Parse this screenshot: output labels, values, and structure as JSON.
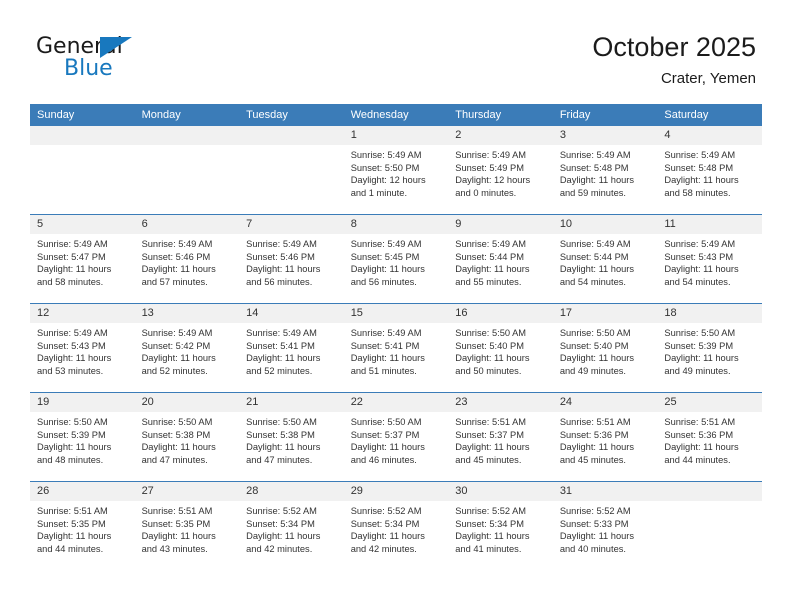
{
  "logo": {
    "word_one": "General",
    "word_two": "Blue",
    "triangle_color": "#1878be",
    "text_color": "#1b1b1b"
  },
  "header": {
    "title": "October 2025",
    "subtitle": "Crater, Yemen"
  },
  "theme": {
    "header_bg": "#3b7cb8",
    "header_text": "#ffffff",
    "date_band_bg": "#f1f1f1",
    "row_divider": "#3b7cb8",
    "body_text": "#333333"
  },
  "calendar": {
    "weekday_headers": [
      "Sunday",
      "Monday",
      "Tuesday",
      "Wednesday",
      "Thursday",
      "Friday",
      "Saturday"
    ],
    "weeks": [
      [
        {
          "date": "",
          "empty": true,
          "sunrise": "",
          "sunset": "",
          "daylight": ""
        },
        {
          "date": "",
          "empty": true,
          "sunrise": "",
          "sunset": "",
          "daylight": ""
        },
        {
          "date": "",
          "empty": true,
          "sunrise": "",
          "sunset": "",
          "daylight": ""
        },
        {
          "date": "1",
          "empty": false,
          "sunrise": "Sunrise: 5:49 AM",
          "sunset": "Sunset: 5:50 PM",
          "daylight": "Daylight: 12 hours and 1 minute."
        },
        {
          "date": "2",
          "empty": false,
          "sunrise": "Sunrise: 5:49 AM",
          "sunset": "Sunset: 5:49 PM",
          "daylight": "Daylight: 12 hours and 0 minutes."
        },
        {
          "date": "3",
          "empty": false,
          "sunrise": "Sunrise: 5:49 AM",
          "sunset": "Sunset: 5:48 PM",
          "daylight": "Daylight: 11 hours and 59 minutes."
        },
        {
          "date": "4",
          "empty": false,
          "sunrise": "Sunrise: 5:49 AM",
          "sunset": "Sunset: 5:48 PM",
          "daylight": "Daylight: 11 hours and 58 minutes."
        }
      ],
      [
        {
          "date": "5",
          "empty": false,
          "sunrise": "Sunrise: 5:49 AM",
          "sunset": "Sunset: 5:47 PM",
          "daylight": "Daylight: 11 hours and 58 minutes."
        },
        {
          "date": "6",
          "empty": false,
          "sunrise": "Sunrise: 5:49 AM",
          "sunset": "Sunset: 5:46 PM",
          "daylight": "Daylight: 11 hours and 57 minutes."
        },
        {
          "date": "7",
          "empty": false,
          "sunrise": "Sunrise: 5:49 AM",
          "sunset": "Sunset: 5:46 PM",
          "daylight": "Daylight: 11 hours and 56 minutes."
        },
        {
          "date": "8",
          "empty": false,
          "sunrise": "Sunrise: 5:49 AM",
          "sunset": "Sunset: 5:45 PM",
          "daylight": "Daylight: 11 hours and 56 minutes."
        },
        {
          "date": "9",
          "empty": false,
          "sunrise": "Sunrise: 5:49 AM",
          "sunset": "Sunset: 5:44 PM",
          "daylight": "Daylight: 11 hours and 55 minutes."
        },
        {
          "date": "10",
          "empty": false,
          "sunrise": "Sunrise: 5:49 AM",
          "sunset": "Sunset: 5:44 PM",
          "daylight": "Daylight: 11 hours and 54 minutes."
        },
        {
          "date": "11",
          "empty": false,
          "sunrise": "Sunrise: 5:49 AM",
          "sunset": "Sunset: 5:43 PM",
          "daylight": "Daylight: 11 hours and 54 minutes."
        }
      ],
      [
        {
          "date": "12",
          "empty": false,
          "sunrise": "Sunrise: 5:49 AM",
          "sunset": "Sunset: 5:43 PM",
          "daylight": "Daylight: 11 hours and 53 minutes."
        },
        {
          "date": "13",
          "empty": false,
          "sunrise": "Sunrise: 5:49 AM",
          "sunset": "Sunset: 5:42 PM",
          "daylight": "Daylight: 11 hours and 52 minutes."
        },
        {
          "date": "14",
          "empty": false,
          "sunrise": "Sunrise: 5:49 AM",
          "sunset": "Sunset: 5:41 PM",
          "daylight": "Daylight: 11 hours and 52 minutes."
        },
        {
          "date": "15",
          "empty": false,
          "sunrise": "Sunrise: 5:49 AM",
          "sunset": "Sunset: 5:41 PM",
          "daylight": "Daylight: 11 hours and 51 minutes."
        },
        {
          "date": "16",
          "empty": false,
          "sunrise": "Sunrise: 5:50 AM",
          "sunset": "Sunset: 5:40 PM",
          "daylight": "Daylight: 11 hours and 50 minutes."
        },
        {
          "date": "17",
          "empty": false,
          "sunrise": "Sunrise: 5:50 AM",
          "sunset": "Sunset: 5:40 PM",
          "daylight": "Daylight: 11 hours and 49 minutes."
        },
        {
          "date": "18",
          "empty": false,
          "sunrise": "Sunrise: 5:50 AM",
          "sunset": "Sunset: 5:39 PM",
          "daylight": "Daylight: 11 hours and 49 minutes."
        }
      ],
      [
        {
          "date": "19",
          "empty": false,
          "sunrise": "Sunrise: 5:50 AM",
          "sunset": "Sunset: 5:39 PM",
          "daylight": "Daylight: 11 hours and 48 minutes."
        },
        {
          "date": "20",
          "empty": false,
          "sunrise": "Sunrise: 5:50 AM",
          "sunset": "Sunset: 5:38 PM",
          "daylight": "Daylight: 11 hours and 47 minutes."
        },
        {
          "date": "21",
          "empty": false,
          "sunrise": "Sunrise: 5:50 AM",
          "sunset": "Sunset: 5:38 PM",
          "daylight": "Daylight: 11 hours and 47 minutes."
        },
        {
          "date": "22",
          "empty": false,
          "sunrise": "Sunrise: 5:50 AM",
          "sunset": "Sunset: 5:37 PM",
          "daylight": "Daylight: 11 hours and 46 minutes."
        },
        {
          "date": "23",
          "empty": false,
          "sunrise": "Sunrise: 5:51 AM",
          "sunset": "Sunset: 5:37 PM",
          "daylight": "Daylight: 11 hours and 45 minutes."
        },
        {
          "date": "24",
          "empty": false,
          "sunrise": "Sunrise: 5:51 AM",
          "sunset": "Sunset: 5:36 PM",
          "daylight": "Daylight: 11 hours and 45 minutes."
        },
        {
          "date": "25",
          "empty": false,
          "sunrise": "Sunrise: 5:51 AM",
          "sunset": "Sunset: 5:36 PM",
          "daylight": "Daylight: 11 hours and 44 minutes."
        }
      ],
      [
        {
          "date": "26",
          "empty": false,
          "sunrise": "Sunrise: 5:51 AM",
          "sunset": "Sunset: 5:35 PM",
          "daylight": "Daylight: 11 hours and 44 minutes."
        },
        {
          "date": "27",
          "empty": false,
          "sunrise": "Sunrise: 5:51 AM",
          "sunset": "Sunset: 5:35 PM",
          "daylight": "Daylight: 11 hours and 43 minutes."
        },
        {
          "date": "28",
          "empty": false,
          "sunrise": "Sunrise: 5:52 AM",
          "sunset": "Sunset: 5:34 PM",
          "daylight": "Daylight: 11 hours and 42 minutes."
        },
        {
          "date": "29",
          "empty": false,
          "sunrise": "Sunrise: 5:52 AM",
          "sunset": "Sunset: 5:34 PM",
          "daylight": "Daylight: 11 hours and 42 minutes."
        },
        {
          "date": "30",
          "empty": false,
          "sunrise": "Sunrise: 5:52 AM",
          "sunset": "Sunset: 5:34 PM",
          "daylight": "Daylight: 11 hours and 41 minutes."
        },
        {
          "date": "31",
          "empty": false,
          "sunrise": "Sunrise: 5:52 AM",
          "sunset": "Sunset: 5:33 PM",
          "daylight": "Daylight: 11 hours and 40 minutes."
        },
        {
          "date": "",
          "empty": true,
          "sunrise": "",
          "sunset": "",
          "daylight": ""
        }
      ]
    ]
  }
}
